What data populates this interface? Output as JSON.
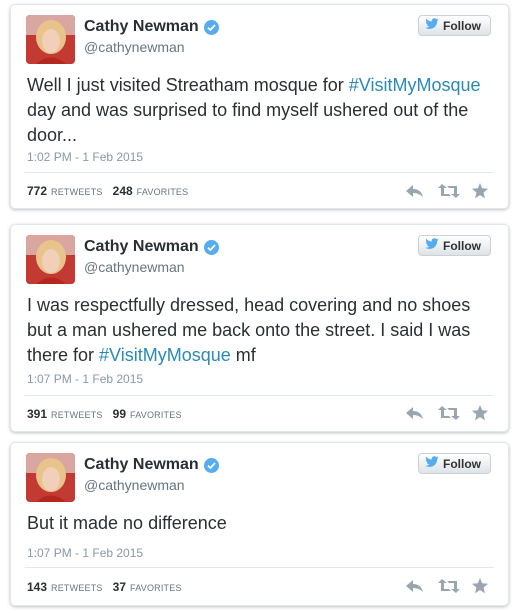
{
  "tweets": [
    {
      "name": "Cathy Newman",
      "handle": "@cathynewman",
      "follow_label": "Follow",
      "text_parts": [
        "Well I just visited Streatham mosque for ",
        "#VisitMyMosque",
        " day and was surprised to find myself ushered out of the door..."
      ],
      "timestamp": "1:02 PM - 1 Feb 2015",
      "retweets": "772",
      "retweets_label": "RETWEETS",
      "favorites": "248",
      "favorites_label": "FAVORITES"
    },
    {
      "name": "Cathy Newman",
      "handle": "@cathynewman",
      "follow_label": "Follow",
      "text_parts": [
        "I was respectfully dressed, head covering and no shoes but a man ushered me back onto the street. I said I was there for ",
        "#VisitMyMosque",
        " mf"
      ],
      "timestamp": "1:07 PM - 1 Feb 2015",
      "retweets": "391",
      "retweets_label": "RETWEETS",
      "favorites": "99",
      "favorites_label": "FAVORITES"
    },
    {
      "name": "Cathy Newman",
      "handle": "@cathynewman",
      "follow_label": "Follow",
      "text_parts": [
        "But it made no difference",
        "",
        ""
      ],
      "timestamp": "1:07 PM - 1 Feb 2015",
      "retweets": "143",
      "retweets_label": "RETWEETS",
      "favorites": "37",
      "favorites_label": "FAVORITES"
    }
  ],
  "colors": {
    "hashtag": "#2a8ab7",
    "verified": "#55acee",
    "twitter_bird": "#55acee"
  },
  "icons": [
    "verified-badge-icon",
    "twitter-bird-icon",
    "reply-icon",
    "retweet-icon",
    "favorite-star-icon"
  ]
}
